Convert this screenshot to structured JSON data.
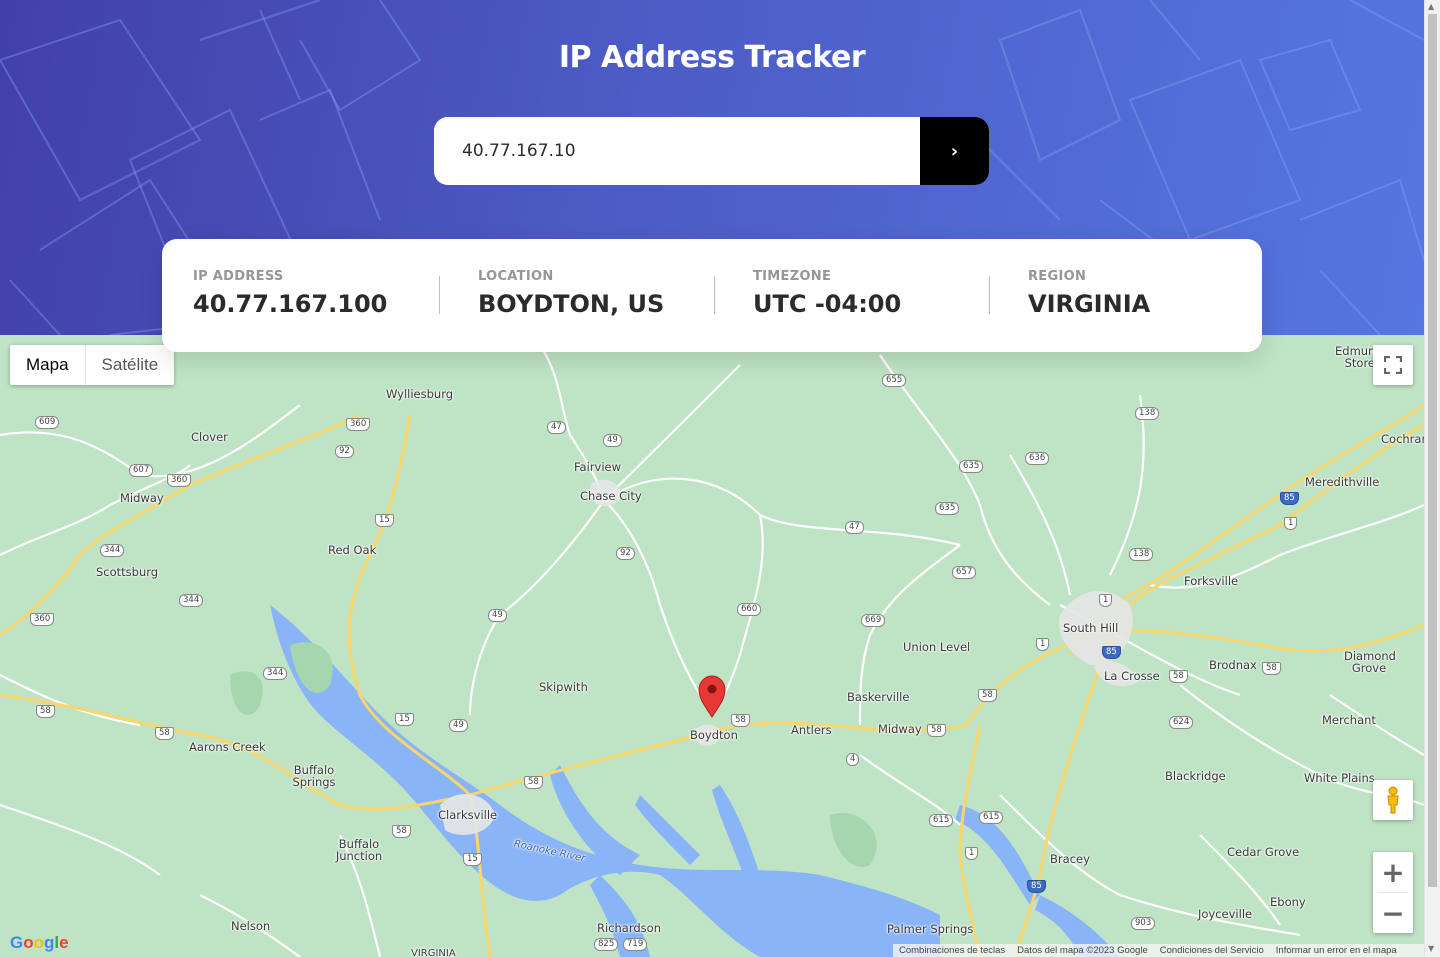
{
  "app": {
    "title": "IP Address Tracker"
  },
  "search": {
    "value": "40.77.167.10",
    "submit_label": "›"
  },
  "info": {
    "ip_label": "IP ADDRESS",
    "ip_value": "40.77.167.100",
    "location_label": "LOCATION",
    "location_value": "BOYDTON, US",
    "timezone_label": "TIMEZONE",
    "timezone_value": "UTC -04:00",
    "region_label": "REGION",
    "region_value": "VIRGINIA"
  },
  "map": {
    "type_map": "Mapa",
    "type_satellite": "Satélite",
    "zoom_in": "+",
    "zoom_out": "−",
    "logo": "Google",
    "footer": [
      "Combinaciones de teclas",
      "Datos del mapa ©2023 Google",
      "Condiciones del Servicio",
      "Informar un error en el mapa"
    ],
    "places": [
      {
        "name": "Wylliesburg"
      },
      {
        "name": "Clover"
      },
      {
        "name": "Midway"
      },
      {
        "name": "Fairview"
      },
      {
        "name": "Chase City"
      },
      {
        "name": "Red Oak"
      },
      {
        "name": "Scottsburg"
      },
      {
        "name": "Skipwith"
      },
      {
        "name": "Boydton"
      },
      {
        "name": "Antlers"
      },
      {
        "name": "Midway"
      },
      {
        "name": "Baskerville"
      },
      {
        "name": "Union Level"
      },
      {
        "name": "South Hill"
      },
      {
        "name": "La Crosse"
      },
      {
        "name": "Brodnax"
      },
      {
        "name": "Forksville"
      },
      {
        "name": "Meredithville"
      },
      {
        "name": "Cochran"
      },
      {
        "name": "Edmunds Store"
      },
      {
        "name": "Diamond Grove"
      },
      {
        "name": "Merchant"
      },
      {
        "name": "White Plains"
      },
      {
        "name": "Blackridge"
      },
      {
        "name": "Cedar Grove"
      },
      {
        "name": "Ebony"
      },
      {
        "name": "Joyceville"
      },
      {
        "name": "Bracey"
      },
      {
        "name": "Palmer Springs"
      },
      {
        "name": "Richardson"
      },
      {
        "name": "Nelson"
      },
      {
        "name": "Buffalo Junction"
      },
      {
        "name": "Clarksville"
      },
      {
        "name": "Buffalo Springs"
      },
      {
        "name": "Aarons Creek"
      },
      {
        "name": "Roanoke River"
      },
      {
        "name": "VIRGINIA"
      }
    ],
    "colors": {
      "land": "#bfe3c5",
      "water": "#8ab4f8",
      "highway": "#f8d66b",
      "marker": "#e53935"
    }
  }
}
